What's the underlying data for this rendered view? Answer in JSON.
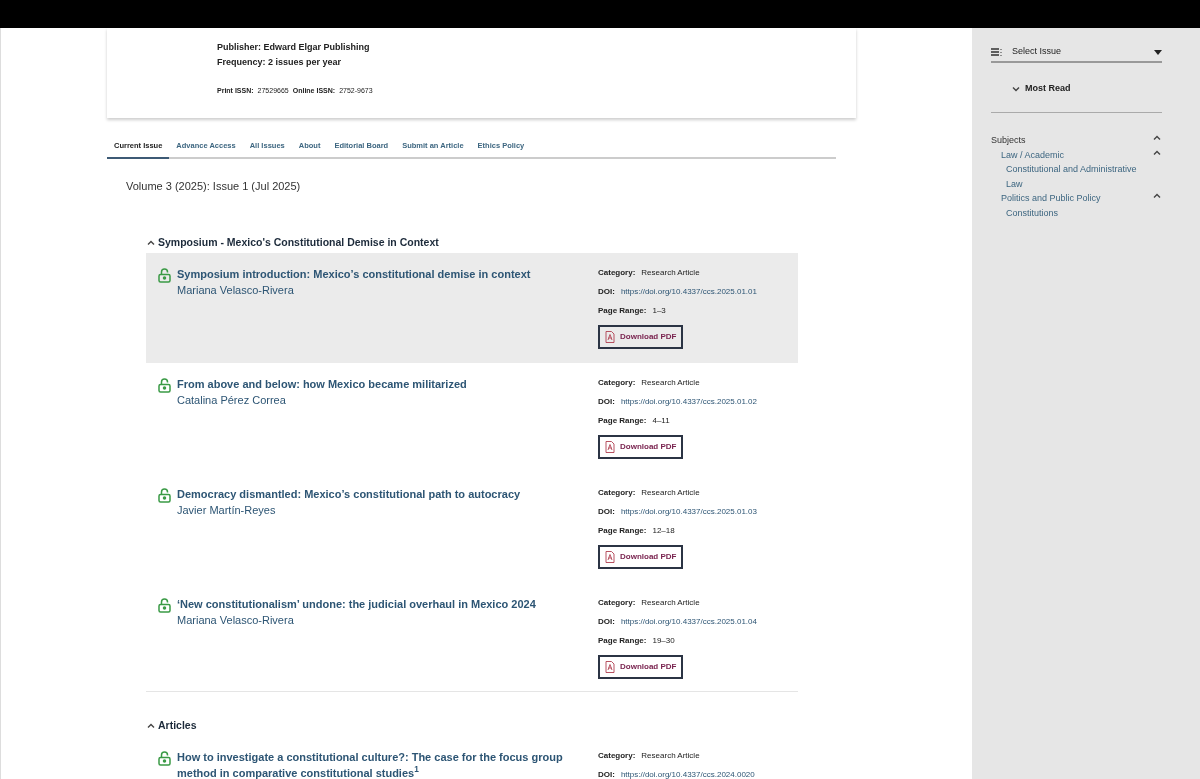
{
  "journal": {
    "publisher": "Publisher: Edward Elgar Publishing",
    "frequency": "Frequency: 2 issues per year",
    "print_issn_label": "Print ISSN:",
    "print_issn": "27529665",
    "online_issn_label": "Online ISSN:",
    "online_issn": "2752-9673"
  },
  "tabs": [
    {
      "label": "Current Issue",
      "selected": true
    },
    {
      "label": "Advance Access",
      "selected": false
    },
    {
      "label": "All Issues",
      "selected": false
    },
    {
      "label": "About",
      "selected": false
    },
    {
      "label": "Editorial Board",
      "selected": false
    },
    {
      "label": "Submit an Article",
      "selected": false
    },
    {
      "label": "Ethics Policy",
      "selected": false
    }
  ],
  "issue_title": "Volume 3 (2025): Issue 1 (Jul 2025)",
  "sections": [
    {
      "heading": "Symposium - Mexico's Constitutional Demise in Context",
      "expanded": true,
      "articles": [
        {
          "title": "Symposium introduction: Mexico’s constitutional demise in context",
          "author": "Mariana Velasco-Rivera",
          "selected": true,
          "category_label": "Category:",
          "category": "Research Article",
          "doi_label": "DOI:",
          "doi": "https://doi.org/10.4337/ccs.2025.01.01",
          "page_range_label": "Page Range:",
          "page_range": "1–3",
          "download": "Download PDF"
        },
        {
          "title": "From above and below: how Mexico became militarized",
          "author": "Catalina Pérez Correa",
          "selected": false,
          "category_label": "Category:",
          "category": "Research Article",
          "doi_label": "DOI:",
          "doi": "https://doi.org/10.4337/ccs.2025.01.02",
          "page_range_label": "Page Range:",
          "page_range": "4–11",
          "download": "Download PDF"
        },
        {
          "title": "Democracy dismantled: Mexico’s constitutional path to autocracy",
          "author": "Javier Martín-Reyes",
          "selected": false,
          "category_label": "Category:",
          "category": "Research Article",
          "doi_label": "DOI:",
          "doi": "https://doi.org/10.4337/ccs.2025.01.03",
          "page_range_label": "Page Range:",
          "page_range": "12–18",
          "download": "Download PDF"
        },
        {
          "title": "‘New constitutionalism’ undone: the judicial overhaul in Mexico 2024",
          "author": "Mariana Velasco-Rivera",
          "selected": false,
          "category_label": "Category:",
          "category": "Research Article",
          "doi_label": "DOI:",
          "doi": "https://doi.org/10.4337/ccs.2025.01.04",
          "page_range_label": "Page Range:",
          "page_range": "19–30",
          "download": "Download PDF"
        }
      ]
    },
    {
      "heading": "Articles",
      "expanded": true,
      "articles": [
        {
          "title": "How to investigate a constitutional culture?: The case for the focus group method in comparative constitutional studies$^{1}$",
          "selected": false,
          "category_label": "Category:",
          "category": "Research Article",
          "doi_label": "DOI:",
          "doi": "https://doi.org/10.4337/ccs.2024.0020"
        }
      ]
    }
  ],
  "sidebar": {
    "select_issue": "Select Issue",
    "most_read": {
      "label": "Most Read",
      "expanded": false
    },
    "subjects": [
      {
        "label": "Subjects",
        "expanded": true,
        "children": [
          {
            "label": "Law / Academic",
            "expanded": true,
            "children": [
              {
                "label": "Constitutional and Administrative Law"
              }
            ]
          },
          {
            "label": "Politics and Public Policy",
            "expanded": true,
            "children": [
              {
                "label": "Constitutions"
              }
            ]
          }
        ]
      }
    ]
  }
}
